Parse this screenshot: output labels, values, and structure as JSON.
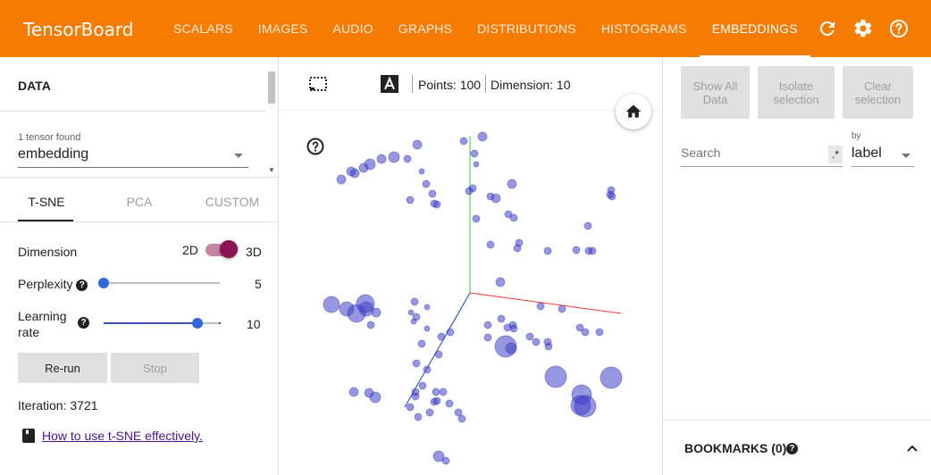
{
  "header": {
    "brand": "TensorBoard",
    "tabs": [
      {
        "label": "SCALARS",
        "active": false
      },
      {
        "label": "IMAGES",
        "active": false
      },
      {
        "label": "AUDIO",
        "active": false
      },
      {
        "label": "GRAPHS",
        "active": false
      },
      {
        "label": "DISTRIBUTIONS",
        "active": false
      },
      {
        "label": "HISTOGRAMS",
        "active": false
      },
      {
        "label": "EMBEDDINGS",
        "active": true
      }
    ],
    "icons": [
      "refresh-icon",
      "settings-icon",
      "help-icon"
    ],
    "color": "#f57c00"
  },
  "left": {
    "data_title": "DATA",
    "tensor_count": "1 tensor found",
    "tensor_selected": "embedding",
    "projection_tabs": [
      "T-SNE",
      "PCA",
      "CUSTOM"
    ],
    "active_projection": "T-SNE",
    "dimension": {
      "label": "Dimension",
      "opt_2d": "2D",
      "opt_3d": "3D",
      "selected": "3D"
    },
    "perplexity": {
      "label": "Perplexity",
      "value": "5",
      "fraction": 0.0
    },
    "learning_rate": {
      "label_line1": "Learning",
      "label_line2": "rate",
      "value": "10",
      "fraction": 0.8
    },
    "rerun_label": "Re-run",
    "stop_label": "Stop",
    "iteration": "Iteration: 3721",
    "howto_link": "How to use t-SNE effectively."
  },
  "center": {
    "toolbar": {
      "icons": [
        "selection-icon",
        "night-mode-icon",
        "labels-icon"
      ],
      "points": "Points: 100",
      "dimension": "Dimension: 10"
    },
    "point_color": "#3f3fc9"
  },
  "right": {
    "buttons": {
      "show_all_1": "Show All",
      "show_all_2": "Data",
      "isolate_1": "Isolate",
      "isolate_2": "selection",
      "clear_1": "Clear",
      "clear_2": "selection"
    },
    "search_placeholder": "Search",
    "regex_label": ".*",
    "by_label": "by",
    "by_value": "label",
    "bookmarks": "BOOKMARKS (0)"
  }
}
